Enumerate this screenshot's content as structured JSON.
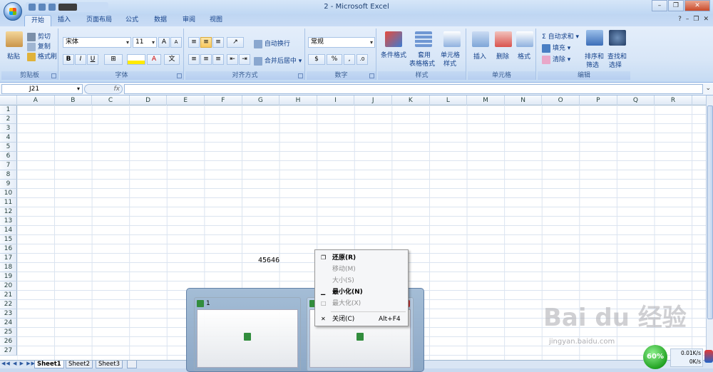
{
  "window": {
    "title": "2 - Microsoft Excel"
  },
  "ribbon_tabs": [
    "开始",
    "插入",
    "页面布局",
    "公式",
    "数据",
    "审阅",
    "视图"
  ],
  "clipboard": {
    "paste": "粘贴",
    "cut": "剪切",
    "copy": "复制",
    "format_painter": "格式刷",
    "label": "剪贴板"
  },
  "font": {
    "name": "宋体",
    "size": "11",
    "grow": "A",
    "shrink": "A",
    "bold": "B",
    "italic": "I",
    "underline": "U",
    "label": "字体"
  },
  "alignment": {
    "wrap": "自动换行",
    "merge": "合并后居中",
    "label": "对齐方式"
  },
  "number": {
    "format": "常规",
    "percent": "%",
    "comma": ",",
    "label": "数字"
  },
  "styles": {
    "cond": "条件格式",
    "table1": "套用",
    "table2": "表格格式",
    "cell1": "单元格",
    "cell2": "样式",
    "label": "样式"
  },
  "cells": {
    "insert": "插入",
    "delete": "删除",
    "format": "格式",
    "label": "单元格"
  },
  "editing": {
    "autosum": "自动求和",
    "fill": "填充",
    "clear": "清除",
    "sort1": "排序和",
    "sort2": "筛选",
    "find1": "查找和",
    "find2": "选择",
    "label": "编辑"
  },
  "formula_bar": {
    "name_box": "J21",
    "fx": "fx",
    "value": ""
  },
  "columns": [
    "A",
    "B",
    "C",
    "D",
    "E",
    "F",
    "G",
    "H",
    "I",
    "J",
    "K",
    "L",
    "M",
    "N",
    "O",
    "P",
    "Q",
    "R"
  ],
  "rows": [
    "1",
    "2",
    "3",
    "4",
    "5",
    "6",
    "7",
    "8",
    "9",
    "10",
    "11",
    "12",
    "13",
    "14",
    "15",
    "16",
    "17",
    "18",
    "19",
    "20",
    "21",
    "22",
    "23",
    "24",
    "25",
    "26",
    "27"
  ],
  "cell_value": "45646",
  "sheets": [
    "Sheet1",
    "Sheet2",
    "Sheet3"
  ],
  "thumbnails": [
    {
      "caption": "1"
    },
    {
      "caption": ""
    }
  ],
  "context_menu": [
    {
      "label": "还原(R)",
      "icon": "restore-icon",
      "enabled": true,
      "bold": true,
      "accel": ""
    },
    {
      "label": "移动(M)",
      "icon": "",
      "enabled": false,
      "bold": false,
      "accel": ""
    },
    {
      "label": "大小(S)",
      "icon": "",
      "enabled": false,
      "bold": false,
      "accel": ""
    },
    {
      "label": "最小化(N)",
      "icon": "minimize-icon",
      "enabled": true,
      "bold": true,
      "accel": ""
    },
    {
      "label": "最大化(X)",
      "icon": "maximize-icon",
      "enabled": false,
      "bold": false,
      "accel": ""
    },
    {
      "label": "关闭(C)",
      "icon": "close-icon",
      "enabled": true,
      "bold": false,
      "accel": "Alt+F4"
    }
  ],
  "watermark": {
    "brand": "Bai du 经验",
    "url": "jingyan.baidu.com"
  },
  "network": {
    "percent": "60%",
    "up": "0.01K/s",
    "down": "0K/s"
  }
}
